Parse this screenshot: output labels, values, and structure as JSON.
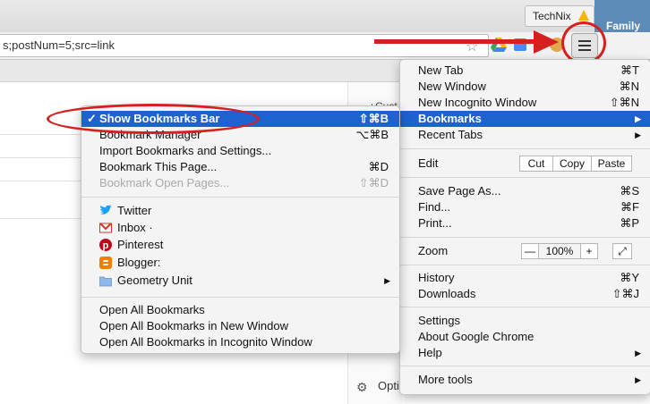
{
  "browser": {
    "profile_name": "TechNix",
    "desktop_label": "Family Drive",
    "url": "s;postNum=5;src=link",
    "partial_page_text": "Opti",
    "partial_top_text": "+Cust"
  },
  "main_menu": {
    "items": [
      {
        "label": "New Tab",
        "shortcut": "⌘T"
      },
      {
        "label": "New Window",
        "shortcut": "⌘N"
      },
      {
        "label": "New Incognito Window",
        "shortcut": "⇧⌘N"
      },
      {
        "label": "Bookmarks",
        "arrow": "▶"
      },
      {
        "label": "Recent Tabs",
        "arrow": "▶"
      },
      {
        "label": "Edit"
      },
      {
        "label": "Save Page As...",
        "shortcut": "⌘S"
      },
      {
        "label": "Find...",
        "shortcut": "⌘F"
      },
      {
        "label": "Print...",
        "shortcut": "⌘P"
      },
      {
        "label": "Zoom"
      },
      {
        "label": "History",
        "shortcut": "⌘Y"
      },
      {
        "label": "Downloads",
        "shortcut": "⇧⌘J"
      },
      {
        "label": "Settings"
      },
      {
        "label": "About Google Chrome"
      },
      {
        "label": "Help",
        "arrow": "▶"
      },
      {
        "label": "More tools",
        "arrow": "▶"
      }
    ],
    "edit_buttons": {
      "cut": "Cut",
      "copy": "Copy",
      "paste": "Paste"
    },
    "zoom": {
      "minus": "—",
      "level": "100%",
      "plus": "+",
      "fullscreen": "⤢"
    }
  },
  "bookmarks_menu": {
    "check": "✓",
    "items": [
      {
        "label": "Show Bookmarks Bar",
        "shortcut": "⇧⌘B"
      },
      {
        "label": "Bookmark Manager",
        "shortcut": "⌥⌘B"
      },
      {
        "label": "Import Bookmarks and Settings..."
      },
      {
        "label": "Bookmark This Page...",
        "shortcut": "⌘D"
      },
      {
        "label": "Bookmark Open Pages...",
        "shortcut": "⇧⌘D"
      },
      {
        "label": "Twitter"
      },
      {
        "label": "Inbox ·"
      },
      {
        "label": "Pinterest"
      },
      {
        "label": "Blogger:"
      },
      {
        "label": "Geometry Unit",
        "arrow": "▶"
      },
      {
        "label": "Open All Bookmarks"
      },
      {
        "label": "Open All Bookmarks in New Window"
      },
      {
        "label": "Open All Bookmarks in Incognito Window"
      }
    ]
  },
  "colors": {
    "highlight": "#1e62d0",
    "annotation_red": "#d6201f",
    "twitter": "#1da1f2",
    "gmail": "#d93025",
    "pinterest": "#bd081c",
    "blogger": "#f57d00",
    "folder": "#8fb8e8"
  }
}
